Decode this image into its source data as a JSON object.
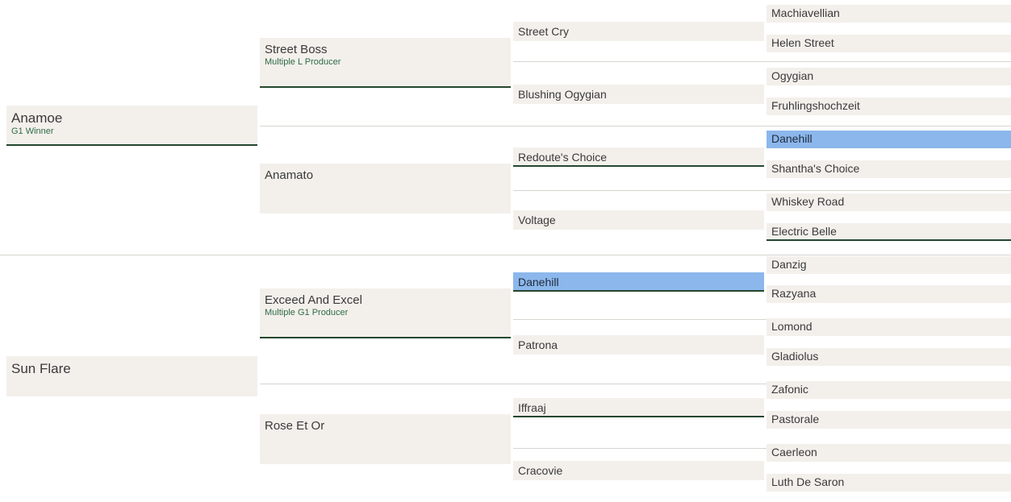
{
  "pedigree": {
    "gen1": [
      {
        "name": "Anamoe",
        "note": "G1 Winner",
        "winner": true,
        "highlight": false
      },
      {
        "name": "Sun Flare",
        "note": "",
        "winner": false,
        "highlight": false
      }
    ],
    "gen2": [
      {
        "name": "Street Boss",
        "note": "Multiple L Producer",
        "winner": true,
        "highlight": false
      },
      {
        "name": "Anamato",
        "note": "",
        "winner": false,
        "highlight": false
      },
      {
        "name": "Exceed And Excel",
        "note": "Multiple G1 Producer",
        "winner": true,
        "highlight": false
      },
      {
        "name": "Rose Et Or",
        "note": "",
        "winner": false,
        "highlight": false
      }
    ],
    "gen3": [
      {
        "name": "Street Cry",
        "note": "",
        "winner": false,
        "highlight": false
      },
      {
        "name": "Blushing Ogygian",
        "note": "",
        "winner": false,
        "highlight": false
      },
      {
        "name": "Redoute's Choice",
        "note": "",
        "winner": true,
        "highlight": false
      },
      {
        "name": "Voltage",
        "note": "",
        "winner": false,
        "highlight": false
      },
      {
        "name": "Danehill",
        "note": "",
        "winner": true,
        "highlight": true
      },
      {
        "name": "Patrona",
        "note": "",
        "winner": false,
        "highlight": false
      },
      {
        "name": "Iffraaj",
        "note": "",
        "winner": true,
        "highlight": false
      },
      {
        "name": "Cracovie",
        "note": "",
        "winner": false,
        "highlight": false
      }
    ],
    "gen4": [
      {
        "name": "Machiavellian",
        "note": "",
        "winner": false,
        "highlight": false
      },
      {
        "name": "Helen Street",
        "note": "",
        "winner": false,
        "highlight": false
      },
      {
        "name": "Ogygian",
        "note": "",
        "winner": false,
        "highlight": false
      },
      {
        "name": "Fruhlingshochzeit",
        "note": "",
        "winner": false,
        "highlight": false
      },
      {
        "name": "Danehill",
        "note": "",
        "winner": false,
        "highlight": true
      },
      {
        "name": "Shantha's Choice",
        "note": "",
        "winner": false,
        "highlight": false
      },
      {
        "name": "Whiskey Road",
        "note": "",
        "winner": false,
        "highlight": false
      },
      {
        "name": "Electric Belle",
        "note": "",
        "winner": true,
        "highlight": false
      },
      {
        "name": "Danzig",
        "note": "",
        "winner": false,
        "highlight": false
      },
      {
        "name": "Razyana",
        "note": "",
        "winner": false,
        "highlight": false
      },
      {
        "name": "Lomond",
        "note": "",
        "winner": false,
        "highlight": false
      },
      {
        "name": "Gladiolus",
        "note": "",
        "winner": false,
        "highlight": false
      },
      {
        "name": "Zafonic",
        "note": "",
        "winner": false,
        "highlight": false
      },
      {
        "name": "Pastorale",
        "note": "",
        "winner": false,
        "highlight": false
      },
      {
        "name": "Caerleon",
        "note": "",
        "winner": false,
        "highlight": false
      },
      {
        "name": "Luth De Saron",
        "note": "",
        "winner": false,
        "highlight": false
      }
    ]
  },
  "colors": {
    "cell_background": "#f3f0ec",
    "highlight": "#8cb7ec",
    "winner_underline": "#24472f",
    "note_text": "#2e6b44",
    "divider": "#d8d5d0"
  }
}
